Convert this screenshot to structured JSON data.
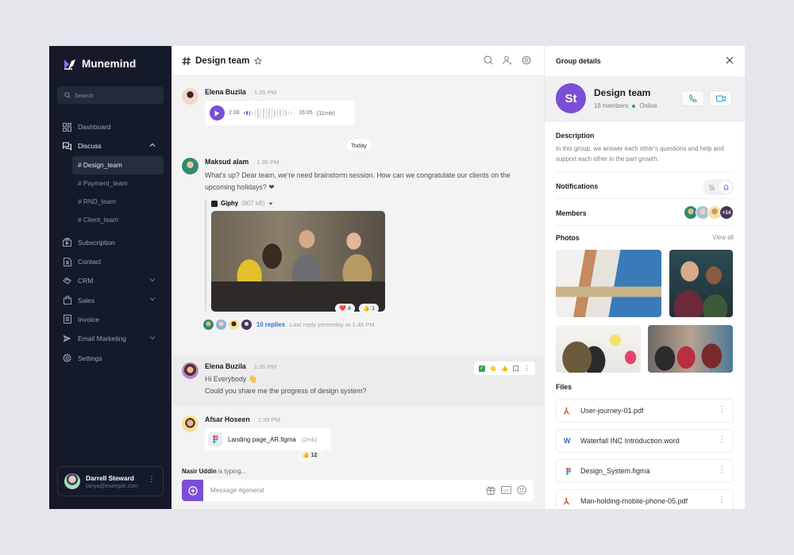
{
  "app": {
    "brand": "Munemind",
    "accent": "#7b4ed6"
  },
  "sidebar": {
    "search_placeholder": "Search",
    "items": [
      {
        "label": "Dashboard",
        "icon": "dashboard-icon"
      },
      {
        "label": "Discuss",
        "icon": "chat-icon",
        "expanded": true
      },
      {
        "label": "Subscription",
        "icon": "subscription-icon"
      },
      {
        "label": "Contact",
        "icon": "contact-icon"
      },
      {
        "label": "CRM",
        "icon": "crm-icon",
        "has_children": true
      },
      {
        "label": "Sales",
        "icon": "bag-icon",
        "has_children": true
      },
      {
        "label": "Invoice",
        "icon": "invoice-icon"
      },
      {
        "label": "Email Marketing",
        "icon": "send-icon",
        "has_children": true
      },
      {
        "label": "Settings",
        "icon": "gear-icon"
      }
    ],
    "channels": [
      {
        "label": "# Design_team",
        "active": true
      },
      {
        "label": "# Payment_team"
      },
      {
        "label": "# RND_team"
      },
      {
        "label": "# Client_team"
      }
    ],
    "user": {
      "name": "Darrell Steward",
      "email": "tanya@example.com"
    }
  },
  "chat": {
    "title": "Design team",
    "today_label": "Today",
    "messages": [
      {
        "author": "Elena Buzila",
        "time": "1:35 PM",
        "audio": {
          "elapsed": "2:38",
          "duration": "16:05",
          "size": "(11mb)",
          "progress": 0.15
        }
      },
      {
        "author": "Maksud alam",
        "time": "1:35 PM",
        "text": "What’s up? Dear team, we’re need brainstorm session. How can we congratulate our clients on the upcoming holidays? ❤",
        "attachment": {
          "name": "Giphy",
          "size": "(807 kB)"
        },
        "reactions": [
          {
            "emoji": "❤️",
            "count": "4"
          },
          {
            "emoji": "👍",
            "count": "1"
          }
        ],
        "replies": {
          "count_label": "10 replies",
          "meta": "Last reply yesterday at 1:46 PM"
        }
      },
      {
        "author": "Elena Buzila",
        "time": "1:35 PM",
        "lines": [
          "Hi Everybody 👋",
          "Could you share me the progress of design system?"
        ]
      },
      {
        "author": "Afsar Hoseen",
        "time": "1:35 PM",
        "file": {
          "name": "Landing page_AR.figma",
          "size": "(2mb)"
        },
        "reactions": [
          {
            "emoji": "👍",
            "count": "12"
          }
        ]
      }
    ],
    "typing": {
      "name": "Nasir Uddin",
      "suffix": " is typing..."
    },
    "composer_placeholder": "Message #general"
  },
  "details": {
    "title": "Group details",
    "group": {
      "initials": "St",
      "name": "Design team",
      "members": "18 members",
      "status": "Online"
    },
    "description_title": "Description",
    "description": "In this group, we answer each other's questions and help and support each other in the part growth.",
    "notifications_title": "Notifications",
    "members_title": "Members",
    "members_extra": "+14",
    "photos_title": "Photos",
    "view_all": "View all",
    "files_title": "Files",
    "files": [
      {
        "name": "User-journey-01.pdf",
        "type": "pdf"
      },
      {
        "name": "Waterfall INC Introduction.word",
        "type": "word"
      },
      {
        "name": "Design_System.figma",
        "type": "figma"
      },
      {
        "name": "Man-holding-mobile-phone-05.pdf",
        "type": "pdf"
      }
    ]
  }
}
